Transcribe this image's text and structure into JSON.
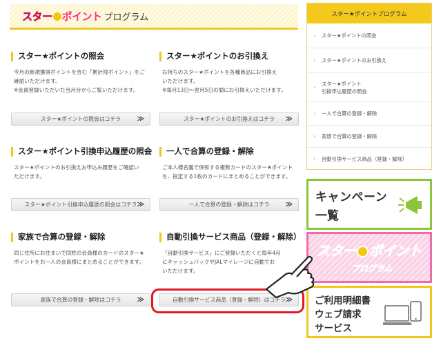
{
  "header": {
    "logo_part1": "スター",
    "logo_part2": "ポイント",
    "title_suffix": "プログラム"
  },
  "sections": [
    {
      "title": "スター★ポイントの照会",
      "desc": [
        "今月の新規獲得ポイントを含む「累計残ポイント」をご",
        "確認いただけます。",
        "※会員登録いただいた当月分からご覧いただけます。"
      ],
      "button": "スター★ポイントの照会はコチラ"
    },
    {
      "title": "スター★ポイントのお引換え",
      "desc": [
        "お持ちのスター★ポイントを各種商品にお引換え",
        "いただけます。",
        "※毎月13日～翌月5日の間にお引換えいただけます。"
      ],
      "button": "スター★ポイントのお引換えはコチラ"
    },
    {
      "title": "スター★ポイント引換申込履歴の照会",
      "desc": [
        "スター★ポイントのお引換えお申込み履歴をご確認い",
        "ただけます。"
      ],
      "button": "スター★ポイント引換申込履歴の照会はコチラ"
    },
    {
      "title": "一人で合算の登録・解除",
      "desc": [
        "ご本人様名義で保有する複数カードのスター★ポイント",
        "を、指定する1枚のカードにまとめることができます。"
      ],
      "button": "一人で合算の登録・解除はコチラ"
    },
    {
      "title": "家族で合算の登録・解除",
      "desc": [
        "同じ住所にお住まいで同姓の会員様のカードのスター★",
        "ポイントをお一人の会員様にまとめることができます。"
      ],
      "button": "家族で合算の登録・解除はコチラ"
    },
    {
      "title": "自動引換サービス商品（登録・解除）",
      "desc": [
        "「自動引換サービス」にご登録いただくと毎年4月",
        "にキャッシュバックやJALマイレージに自動でお",
        "いただけます。"
      ],
      "button": "自動引換サービス商品（登録・解除）はコチラ"
    }
  ],
  "button_arrow": "≫",
  "sidebar": {
    "title": "スター★ポイントプログラム",
    "items": [
      "スター★ポイントの照会",
      "スター★ポイントのお引換え",
      "スター★ポイント",
      "引換申込履歴の照会",
      "一人で合算の登録・解除",
      "家族で合算の登録・解除",
      "自動引換サービス商品（登録・解除）"
    ]
  },
  "banners": {
    "campaign_line1": "キャンペーン",
    "campaign_line2": "一覧",
    "program_star": "スター",
    "program_point": "ポイント",
    "program_sub": "プログラム",
    "statement_line1": "ご利用明細書",
    "statement_line2": "ウェブ請求",
    "statement_line3": "サービス"
  },
  "colors": {
    "accent_yellow": "#f2c61c",
    "brand_pink": "#ff2d86",
    "campaign_green": "#8cc43a",
    "highlight_red": "#e0181f"
  },
  "icons": [
    "megaphone-icon",
    "pointing-hand-icon",
    "laptop-phone-icon",
    "chevron-right-icon"
  ]
}
